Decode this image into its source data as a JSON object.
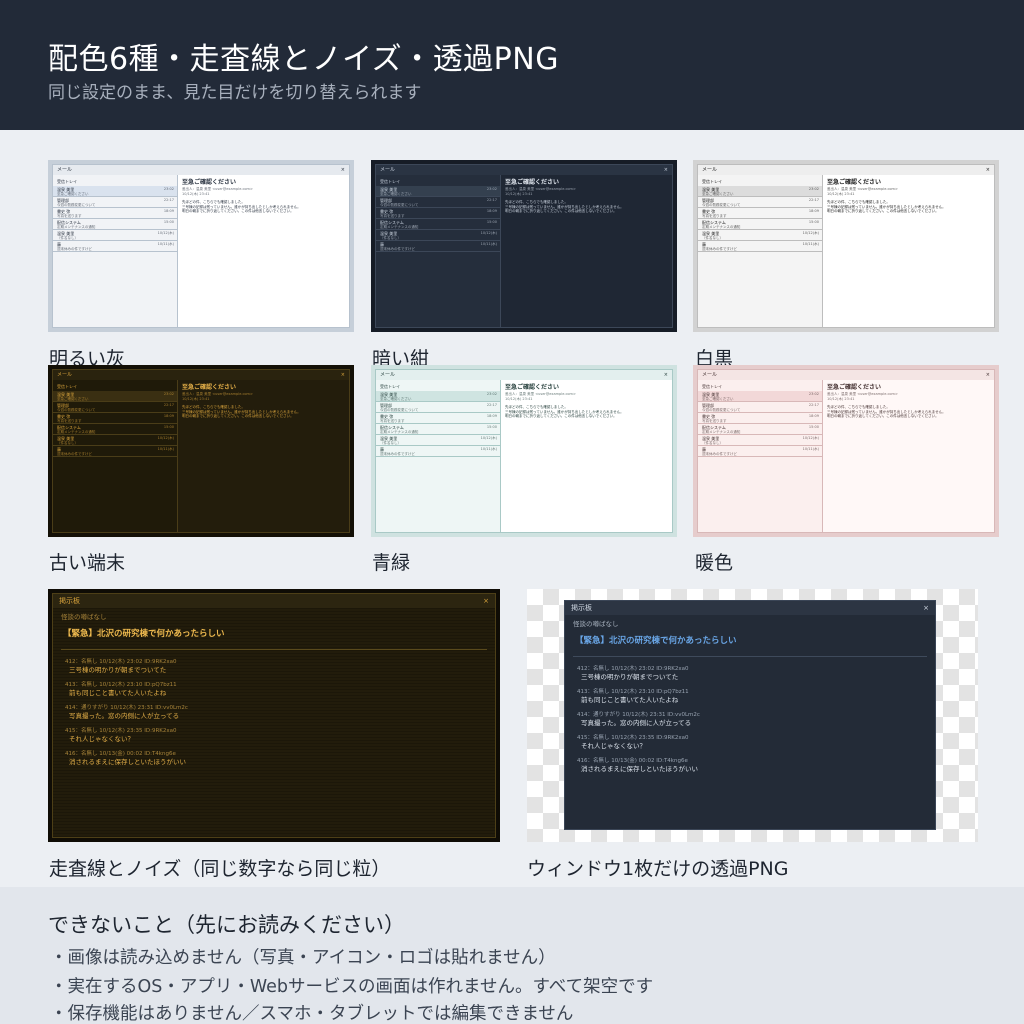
{
  "header": {
    "title": "配色6種・走査線とノイズ・透過PNG",
    "subtitle": "同じ設定のまま、見た目だけを切り替えられます"
  },
  "mini_window": {
    "app_title": "メール",
    "close": "×",
    "inbox": "受信トレイ",
    "items": [
      {
        "from": "温泉 美里",
        "sub": "至急ご確認ください",
        "time": "23:02"
      },
      {
        "from": "管理部",
        "sub": "今週の勤務変更について",
        "time": "22:17"
      },
      {
        "from": "書史 弥",
        "sub": "写真を送ります",
        "time": "18:09"
      },
      {
        "from": "配信システム",
        "sub": "定期メンテナンスの通知",
        "time": "15:00"
      },
      {
        "from": "温泉 美里",
        "sub": "（件名なし）",
        "time": "10/12(木)"
      },
      {
        "from": "藤",
        "sub": "週末休みの件ですけど",
        "time": "10/11(水)"
      }
    ],
    "subject": "至急ご確認ください",
    "meta": [
      "差出人：温泉 美里 <user@example.com>",
      "10/12(木) 23:41"
    ],
    "body": [
      "先ほどの件、こちらでも確認しました。",
      "三号棟の記録は残っていません。誰かが持ち出したとしか考えられません。",
      "明日の朝までに折り返してください。この件は他言しないでください。"
    ]
  },
  "themes": [
    {
      "name": "明るい灰",
      "bg": "#ffffff",
      "side": "#f1f3f6",
      "title": "#e6eaef",
      "border": "#b7c2ce",
      "frame": "#c6cfd9",
      "text": "#2a3340",
      "sel": "#d9e2ee",
      "accent": "#2a3340"
    },
    {
      "name": "暗い紺",
      "bg": "#1f2734",
      "side": "#252e3c",
      "title": "#2a3443",
      "border": "#3c4758",
      "frame": "#161c26",
      "text": "#c9d2de",
      "sel": "#34404f",
      "accent": "#e0e6ee"
    },
    {
      "name": "白黒",
      "bg": "#ffffff",
      "side": "#f4f4f4",
      "title": "#eeeeee",
      "border": "#bdbdbd",
      "frame": "#d2d2d2",
      "text": "#222222",
      "sel": "#dcdcdc",
      "accent": "#222222"
    },
    {
      "name": "古い端末",
      "bg": "#231d0c",
      "side": "#1f1a09",
      "title": "#2a230e",
      "border": "#4a3d18",
      "frame": "#141006",
      "text": "#d9a43c",
      "sel": "#3a2f12",
      "accent": "#e8b24a"
    },
    {
      "name": "青緑",
      "bg": "#ffffff",
      "side": "#eef6f5",
      "title": "#e3efee",
      "border": "#a9c9c6",
      "frame": "#cfe2e0",
      "text": "#27403d",
      "sel": "#cfe4e1",
      "accent": "#27403d"
    },
    {
      "name": "暖色",
      "bg": "#fff8f7",
      "side": "#fbefee",
      "title": "#f4e5e4",
      "border": "#d8b8b8",
      "frame": "#e6cccc",
      "text": "#433030",
      "sel": "#f2d8d8",
      "accent": "#433030"
    }
  ],
  "board": {
    "title": "掲示板",
    "close": "×",
    "sub": "怪談の噂ばなし",
    "thread": "【緊急】北沢の研究棟で何かあったらしい",
    "posts": [
      {
        "head": "412：名無し 10/12(木) 23:02 ID:9RK2xa0",
        "body": "三号棟の明かりが朝までついてた"
      },
      {
        "head": "413：名無し 10/12(木) 23:10 ID:pQ7bz11",
        "body": "前も同じこと書いてた人いたよね"
      },
      {
        "head": "414：通りすがり 10/12(木) 23:31 ID:vv0Lm2c",
        "body": "写真撮った。窓の内側に人が立ってる"
      },
      {
        "head": "415：名無し 10/12(木) 23:35 ID:9RK2xa0",
        "body": "それ人じゃなくない？"
      },
      {
        "head": "416：名無し 10/13(金) 00:02 ID:T4kng6e",
        "body": "消されるまえに保存しといたほうがいい"
      }
    ],
    "caption_noise": "走査線とノイズ（同じ数字なら同じ粒）",
    "caption_png": "ウィンドウ1枚だけの透過PNG"
  },
  "cannot": {
    "heading": "できないこと（先にお読みください）",
    "items": [
      "・画像は読み込めません（写真・アイコン・ロゴは貼れません）",
      "・実在するOS・アプリ・Webサービスの画面は作れません。すべて架空です",
      "・保存機能はありません／スマホ・タブレットでは編集できません"
    ]
  }
}
